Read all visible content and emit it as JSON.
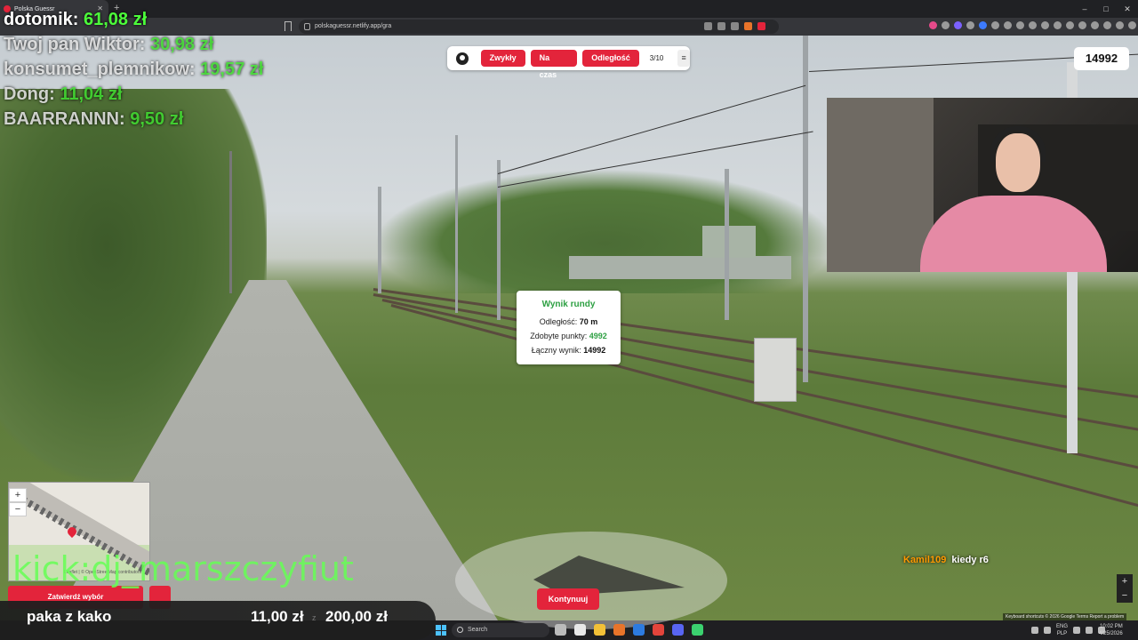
{
  "browser": {
    "tab_title": "Polska Guessr",
    "url": "polskaguessr.netlify.app/gra"
  },
  "leaderboard": [
    {
      "name": "dotomik:",
      "amount": "61,08 zł"
    },
    {
      "name": "Twoj pan Wiktor:",
      "amount": "30,98 zł"
    },
    {
      "name": "konsumet_plemnikow:",
      "amount": "19,57 zł"
    },
    {
      "name": "Dong:",
      "amount": "11,04 zł"
    },
    {
      "name": "BAARRANNN:",
      "amount": "9,50 zł"
    }
  ],
  "game": {
    "modes": [
      "Zwykły",
      "Na czas",
      "Odległość"
    ],
    "round": "3/10",
    "menu_icon": "≡",
    "total_score": "14992",
    "result": {
      "title": "Wynik rundy",
      "distance_label": "Odległość:",
      "distance_value": "70 m",
      "points_label": "Zdobyte punkty:",
      "points_value": "4992",
      "total_label": "Łączny wynik:",
      "total_value": "14992"
    },
    "confirm_button": "Zatwierdź wybór",
    "continue_button": "Kontynuuj",
    "map_zoom_in": "+",
    "map_zoom_out": "−",
    "map_attribution": "Leaflet | © OpenStreetMap contributors"
  },
  "overlay": {
    "kick_text": "kick:dj_marszczyfiut",
    "donation_label": "paka z kako",
    "donation_current": "11,00 zł",
    "donation_separator": "z",
    "donation_goal": "200,00 zł",
    "chat_user": "Kamil109",
    "chat_message": "kiedy r6"
  },
  "streetview": {
    "zoom_in": "+",
    "zoom_out": "−",
    "footer": "Keyboard shortcuts  © 2026 Google  Terms  Report a problem"
  },
  "taskbar": {
    "search_placeholder": "Search",
    "lang_top": "ENG",
    "lang_bottom": "PLP",
    "time": "10:02 PM",
    "date": "4/25/2026"
  }
}
